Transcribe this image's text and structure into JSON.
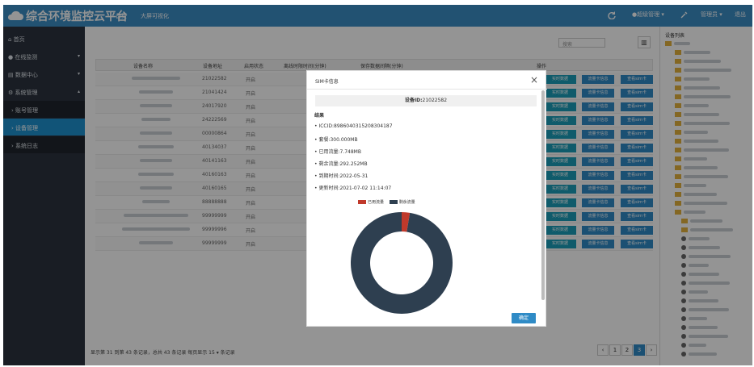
{
  "header": {
    "title": "综合环境监控云平台",
    "nav": [
      "首页",
      "大屏可视化"
    ],
    "right": [
      "●超级管理 ▾",
      "管理员 ▾",
      "退出"
    ]
  },
  "sidebar": {
    "items": [
      {
        "label": "首页",
        "icon": "home-icon"
      },
      {
        "label": "在线监测",
        "icon": "monitor-icon"
      },
      {
        "label": "数据中心",
        "icon": "data-icon"
      },
      {
        "label": "系统管理",
        "icon": "gear-icon"
      },
      {
        "label": "账号管理"
      },
      {
        "label": "设备管理"
      },
      {
        "label": "系统日志"
      }
    ]
  },
  "content": {
    "search_placeholder": "搜索",
    "col_icon": "▥"
  },
  "table": {
    "headers": [
      "设备名称",
      "设备地址",
      "启用状态",
      "离线时限时间(分钟)",
      "保存数据间隔(分钟)",
      "操作"
    ],
    "rows": [
      {
        "addr": "21022582",
        "state": "开启"
      },
      {
        "addr": "21041424",
        "state": "开启"
      },
      {
        "addr": "24017920",
        "state": "开启"
      },
      {
        "addr": "24222569",
        "state": "开启"
      },
      {
        "addr": "00000864",
        "state": "开启"
      },
      {
        "addr": "40134037",
        "state": "开启"
      },
      {
        "addr": "40141163",
        "state": "开启"
      },
      {
        "addr": "40160163",
        "state": "开启"
      },
      {
        "addr": "40160165",
        "state": "开启"
      },
      {
        "addr": "88888888",
        "state": "开启"
      },
      {
        "addr": "99999999",
        "state": "开启"
      },
      {
        "addr": "99999996",
        "state": "开启"
      },
      {
        "addr": "99999999",
        "state": "开启"
      }
    ],
    "actions": [
      "实时数据",
      "流量卡信息",
      "查看sim卡"
    ]
  },
  "pager": {
    "info": "显示第 31 到第 43 条记录，总共 43 条记录 每页显示 15 ▾ 条记录",
    "pages": [
      "‹",
      "1",
      "2",
      "3",
      "›"
    ],
    "current": "3"
  },
  "tree": {
    "title": "设备列表"
  },
  "modal": {
    "title": "SIM卡信息",
    "close": "×",
    "id_label": "设备ID:",
    "id_value": "21022582",
    "section": "结果",
    "details": [
      "ICCID:8986040315208304187",
      "套餐:300.000MB",
      "已用流量:7.748MB",
      "剩余流量:292.252MB",
      "到期时间:2022-05-31",
      "更新时间:2021-07-02 11:14:07"
    ],
    "ok": "确定"
  },
  "chart_data": {
    "type": "pie",
    "title": "",
    "series": [
      {
        "name": "已用流量",
        "value": 7.748,
        "color": "#c0392b"
      },
      {
        "name": "剩余流量",
        "value": 292.252,
        "color": "#2e3f50"
      }
    ],
    "legend": "top",
    "donut": true
  }
}
